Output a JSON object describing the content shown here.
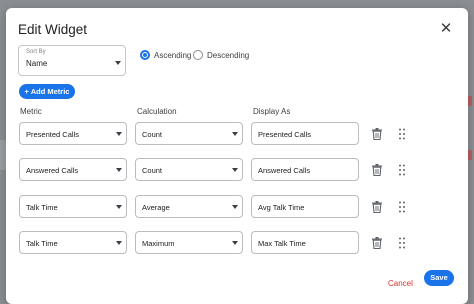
{
  "dialog": {
    "title": "Edit Widget",
    "close_icon": "close-icon"
  },
  "sort": {
    "label": "Sort By",
    "value": "Name",
    "order_options": [
      {
        "label": "Ascending",
        "selected": true
      },
      {
        "label": "Descending",
        "selected": false
      }
    ]
  },
  "add_metric_label": "+ Add Metric",
  "columns": {
    "metric": "Metric",
    "calculation": "Calculation",
    "display_as": "Display As"
  },
  "rows": [
    {
      "metric": "Presented Calls",
      "calculation": "Count",
      "display_as": "Presented Calls"
    },
    {
      "metric": "Answered Calls",
      "calculation": "Count",
      "display_as": "Answered Calls"
    },
    {
      "metric": "Talk Time",
      "calculation": "Average",
      "display_as": "Avg Talk Time"
    },
    {
      "metric": "Talk Time",
      "calculation": "Maximum",
      "display_as": "Max Talk Time"
    }
  ],
  "footer": {
    "cancel_label": "Cancel",
    "save_label": "Save"
  },
  "colors": {
    "accent": "#1a73e8",
    "danger": "#d93025"
  }
}
